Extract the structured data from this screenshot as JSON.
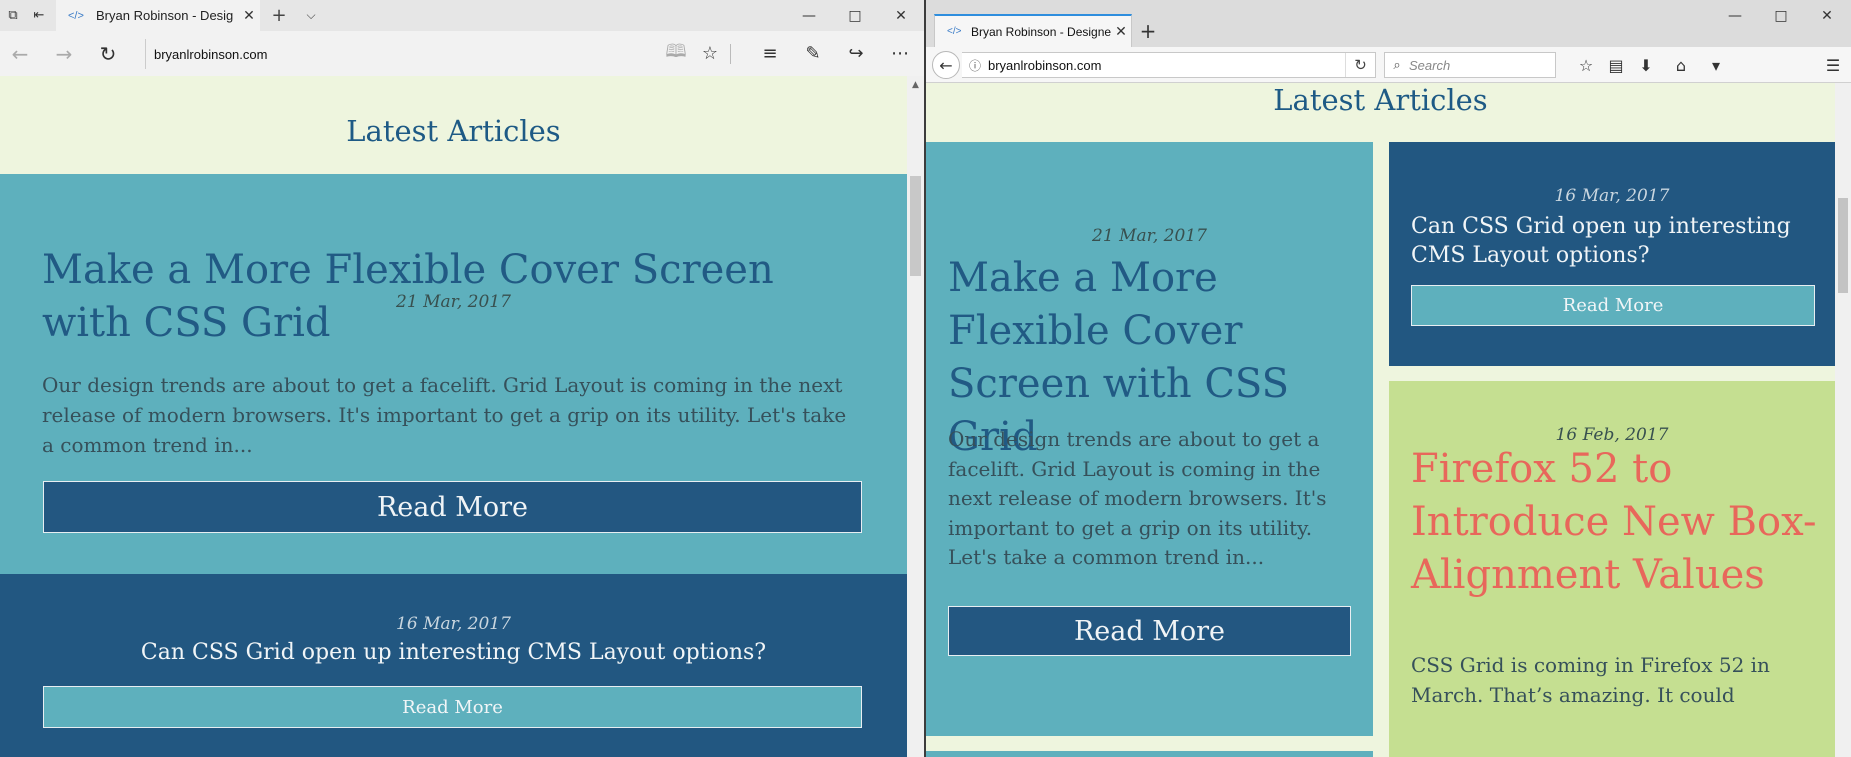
{
  "url": "bryanlrobinson.com",
  "tab_title": "Bryan Robinson - Designer and Developer",
  "edge": {
    "tab_title_visible": "Bryan Robinson - Desig",
    "icons": {
      "tab_manager": "tab-manager-icon",
      "set_aside": "set-aside-tabs-icon",
      "back": "back-arrow-icon",
      "forward": "forward-arrow-icon",
      "refresh": "refresh-icon",
      "reading_view": "reading-view-icon",
      "favorite": "star-icon",
      "hub": "hub-icon",
      "notes": "pen-icon",
      "share": "share-icon",
      "more": "more-icon"
    }
  },
  "firefox": {
    "tab_title_visible": "Bryan Robinson - Designer a",
    "search_placeholder": "Search",
    "icons": {
      "back": "back-arrow-icon",
      "info": "info-icon",
      "reload": "reload-icon",
      "search": "search-icon",
      "bookmark": "star-icon",
      "library": "library-icon",
      "downloads": "download-icon",
      "home": "home-icon",
      "pocket": "pocket-icon",
      "menu": "hamburger-menu-icon"
    }
  },
  "section_heading": "Latest Articles",
  "articles": [
    {
      "date": "21 Mar, 2017",
      "title": "Make a More Flexible Cover Screen with CSS Grid",
      "excerpt": "Our design trends are about to get a facelift. Grid Layout is coming in the next release of modern browsers. It's important to get a grip on its utility. Let's take a common trend in...",
      "button": "Read More"
    },
    {
      "date": "16 Mar, 2017",
      "title": "Can CSS Grid open up interesting CMS Layout options?",
      "button": "Read More"
    },
    {
      "date": "16 Feb, 2017",
      "title": "Firefox 52 to Introduce New Box-Alignment Values",
      "excerpt": "CSS Grid is coming in Firefox 52 in March. That’s amazing. It could"
    }
  ],
  "colors": {
    "page_bg": "#eef5de",
    "teal_card": "#5eb0bd",
    "navy_card": "#225781",
    "green_card": "#c5df91",
    "heading": "#1e5a85",
    "coral_title": "#e8675b"
  }
}
